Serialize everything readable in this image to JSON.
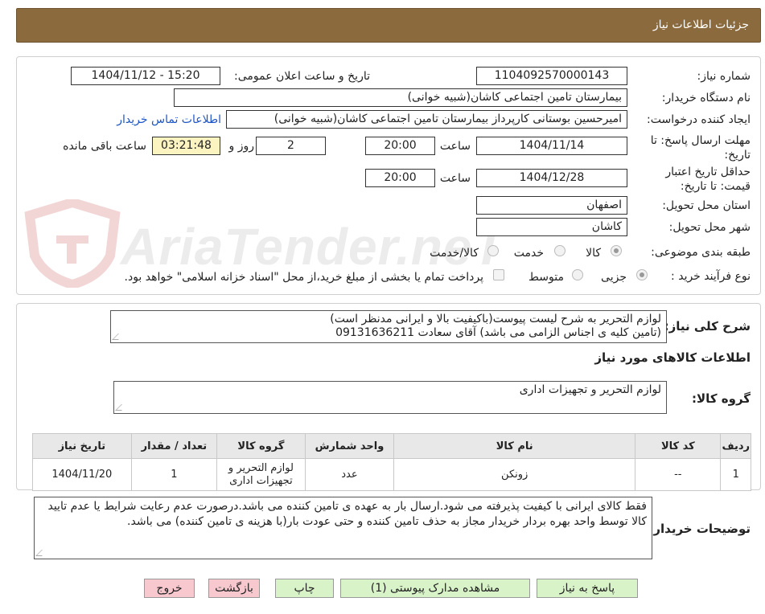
{
  "header": {
    "title": "جزئیات اطلاعات نیاز"
  },
  "watermark": {
    "text": "AriaTender.neT"
  },
  "fields": {
    "need_number_label": "شماره نیاز:",
    "need_number": "1104092570000143",
    "announce_label": "تاریخ و ساعت اعلان عمومی:",
    "announce_value": "1404/11/12 - 15:20",
    "buyer_org_label": "نام دستگاه خریدار:",
    "buyer_org": "بیمارستان تامین اجتماعی کاشان(شبیه خوانی)",
    "requester_label": "ایجاد کننده درخواست:",
    "requester": "امیرحسین بوستانی کارپرداز بیمارستان تامین اجتماعی کاشان(شبیه خوانی)",
    "contact_link": "اطلاعات تماس خریدار",
    "deadline_label": "مهلت ارسال پاسخ: تا تاریخ:",
    "deadline_date": "1404/11/14",
    "hour_label": "ساعت",
    "deadline_time": "20:00",
    "days_value": "2",
    "days_label": "روز و",
    "remaining_time": "03:21:48",
    "remaining_label": "ساعت باقی مانده",
    "validity_label": "حداقل تاریخ اعتبار قیمت: تا تاریخ:",
    "validity_date": "1404/12/28",
    "validity_time": "20:00",
    "province_label": "استان محل تحویل:",
    "province": "اصفهان",
    "city_label": "شهر محل تحویل:",
    "city": "کاشان",
    "category_label": "طبقه بندی موضوعی:",
    "category_options": [
      "کالا",
      "خدمت",
      "کالا/خدمت"
    ],
    "process_label": "نوع فرآیند خرید :",
    "process_options": [
      "جزیی",
      "متوسط"
    ],
    "payment_note": "پرداخت تمام یا بخشی از مبلغ خرید،از محل \"اسناد خزانه اسلامی\" خواهد بود."
  },
  "summary": {
    "label": "شرح کلی نیاز:",
    "line1": "لوازم التحریر به شرح لیست پیوست(باکیفیت بالا و ایرانی مدنظر است)",
    "line2": "(تامین کلیه ی اجناس الزامی می باشد) آقای سعادت 09131636211"
  },
  "goods_info": {
    "title": "اطلاعات کالاهای مورد نیاز",
    "group_label": "گروه کالا:",
    "group_value": "لوازم التحریر و تجهیزات اداری"
  },
  "table": {
    "headers": [
      "ردیف",
      "کد کالا",
      "نام کالا",
      "واحد شمارش",
      "گروه کالا",
      "تعداد / مقدار",
      "تاریخ نیاز"
    ],
    "rows": [
      [
        "1",
        "--",
        "زونکن",
        "عدد",
        "لوازم التحریر و تجهیزات اداری",
        "1",
        "1404/11/20"
      ]
    ]
  },
  "buyer_notes": {
    "label": "توضیحات خریدار:",
    "text": "فقط کالای ایرانی با کیفیت پذیرفته می شود.ارسال بار به عهده ی تامین کننده می باشد.درصورت عدم رعایت شرایط یا عدم تایید کالا توسط واحد بهره بردار خریدار مجاز به حذف تامین کننده و حتی عودت بار(با هزینه ی تامین کننده) می باشد."
  },
  "buttons": {
    "reply": "پاسخ به نیاز",
    "attachments": "مشاهده مدارک پیوستی (1)",
    "print": "چاپ",
    "back": "بازگشت",
    "exit": "خروج"
  },
  "colors": {
    "header": "#8b6a3e",
    "green_button": "#d9f3c9",
    "red_button": "#f8c8cf",
    "timer": "#fbf3c0",
    "link": "#1d55c6"
  }
}
